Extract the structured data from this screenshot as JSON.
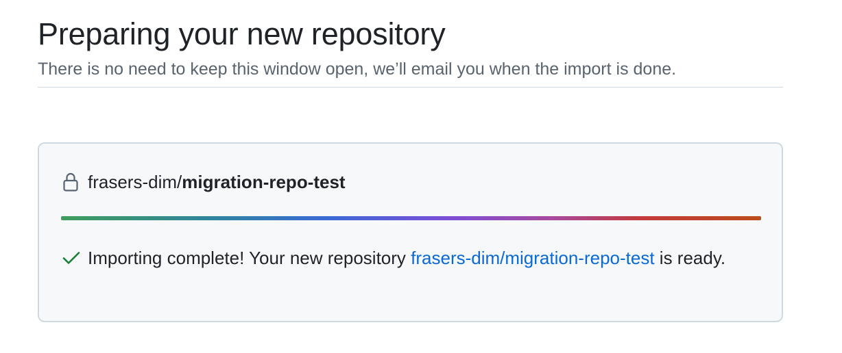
{
  "header": {
    "title": "Preparing your new repository",
    "subtitle": "There is no need to keep this window open, we’ll email you when the import is done."
  },
  "repository": {
    "owner": "frasers-dim",
    "separator": "/",
    "name": "migration-repo-test",
    "visibility_icon": "lock-icon"
  },
  "progress": {
    "percent": 100
  },
  "status": {
    "icon": "check-icon",
    "icon_color": "#1a7f37",
    "message_before": "Importing complete! Your new repository ",
    "link_text": "frasers-dim/migration-repo-test",
    "message_after": " is ready."
  },
  "colors": {
    "link": "#0969da",
    "muted_text": "#59636e",
    "box_background": "#f6f8fa",
    "border": "#d1d9e0"
  }
}
